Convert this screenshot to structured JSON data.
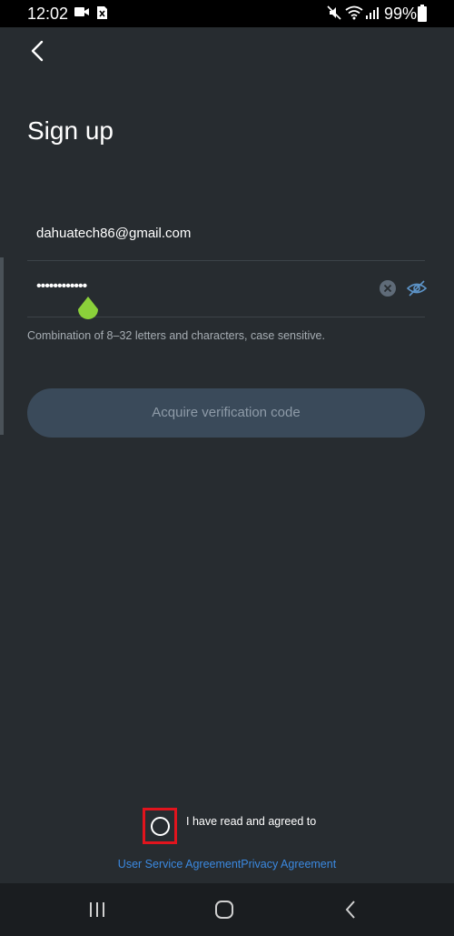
{
  "status_bar": {
    "time": "12:02",
    "battery": "99%",
    "icons": [
      "video-icon",
      "sim-icon",
      "mute-icon",
      "wifi-icon",
      "signal-icon",
      "battery-icon"
    ]
  },
  "page": {
    "title": "Sign up",
    "email_value": "dahuatech86@gmail.com",
    "password_value": "••••••••••••",
    "password_hint": "Combination of 8–32 letters and characters, case sensitive.",
    "acquire_button_label": "Acquire verification code"
  },
  "agreement": {
    "text": "I have read and agreed to",
    "user_service_link": "User Service Agreement",
    "privacy_link": "Privacy Agreement",
    "checked": false
  },
  "colors": {
    "background": "#272c30",
    "button_disabled": "#3a4a5a",
    "link": "#3b89e0",
    "highlight_box": "#e1141d",
    "cursor_handle": "#8bd13a"
  },
  "nav_bar": {
    "icons": [
      "recent-apps-icon",
      "home-icon",
      "back-icon"
    ]
  }
}
